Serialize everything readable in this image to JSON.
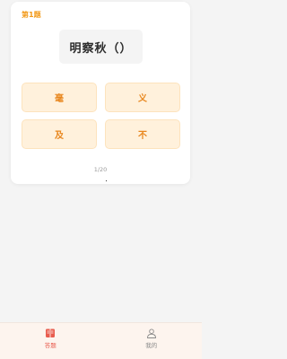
{
  "question": {
    "number_label": "第1题",
    "prompt": "明察秋（）",
    "options": [
      "毫",
      "义",
      "及",
      "不"
    ],
    "progress": "1/20"
  },
  "tabbar": {
    "items": [
      {
        "label": "答题",
        "icon": "book-icon",
        "active": true
      },
      {
        "label": "我的",
        "icon": "user-icon",
        "active": false
      }
    ]
  },
  "colors": {
    "accent": "#f29a1a",
    "option_bg": "#fff1dc",
    "option_text": "#e8861d",
    "tab_active": "#e85d4f",
    "tab_inactive": "#8a8a8a"
  }
}
